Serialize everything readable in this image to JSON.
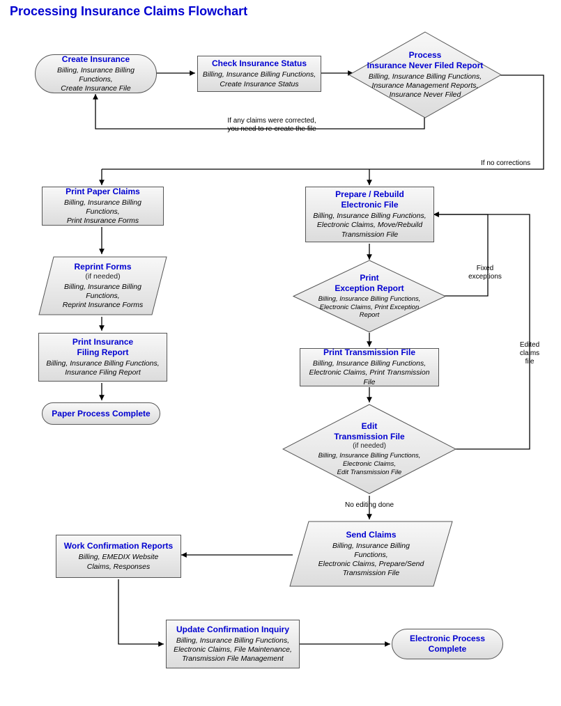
{
  "title": "Processing Insurance Claims Flowchart",
  "createInsurance": {
    "head": [
      "Create Insurance"
    ],
    "sub": [
      "Billing, Insurance Billing Functions,",
      "Create Insurance File"
    ]
  },
  "checkInsurance": {
    "head": [
      "Check Insurance Status"
    ],
    "sub": [
      "Billing, Insurance Billing Functions,",
      "Create Insurance Status"
    ]
  },
  "processNeverFiled": {
    "head": [
      "Process",
      "Insurance Never Filed Report"
    ],
    "sub": [
      "Billing, Insurance Billing Functions,",
      "Insurance Management Reports,",
      "Insurance Never Filed"
    ]
  },
  "printPaperClaims": {
    "head": [
      "Print Paper Claims"
    ],
    "sub": [
      "Billing, Insurance Billing Functions,",
      "Print  Insurance Forms"
    ]
  },
  "reprintForms": {
    "head": [
      "Reprint Forms"
    ],
    "headAfter": "(if needed)",
    "sub": [
      "Billing, Insurance Billing",
      "Functions,",
      "Reprint Insurance Forms"
    ]
  },
  "printFilingReport": {
    "head": [
      "Print Insurance",
      "Filing Report"
    ],
    "sub": [
      "Billing, Insurance Billing Functions,",
      "Insurance Filing Report"
    ]
  },
  "paperComplete": {
    "head": [
      "Paper Process Complete"
    ],
    "sub": []
  },
  "prepareRebuild": {
    "head": [
      "Prepare / Rebuild",
      "Electronic File"
    ],
    "sub": [
      "Billing, Insurance Billing Functions,",
      "Electronic Claims, Move/Rebuild",
      "Transmission File"
    ]
  },
  "printException": {
    "head": [
      "Print",
      "Exception Report"
    ],
    "sub": [
      "Billing, Insurance Billing Functions,",
      "Electronic Claims, Print Exception",
      "Report"
    ]
  },
  "printTransmission": {
    "head": [
      "Print Transmission File"
    ],
    "sub": [
      "Billing, Insurance Billing Functions,",
      "Electronic Claims, Print Transmission File"
    ]
  },
  "editTransmission": {
    "head": [
      "Edit",
      "Transmission File"
    ],
    "headAfter": "(if needed)",
    "sub": [
      "Billing, Insurance Billing Functions,",
      "Electronic Claims,",
      "Edit Transmission File"
    ]
  },
  "sendClaims": {
    "head": [
      "Send Claims"
    ],
    "sub": [
      "Billing, Insurance Billing",
      "Functions,",
      "Electronic Claims, Prepare/Send",
      "Transmission File"
    ]
  },
  "workConfirmation": {
    "head": [
      "Work Confirmation Reports"
    ],
    "sub": [
      "Billing, EMEDIX Website",
      "Claims, Responses"
    ]
  },
  "updateConfirmation": {
    "head": [
      "Update Confirmation Inquiry"
    ],
    "sub": [
      "Billing, Insurance Billing Functions,",
      "Electronic Claims, File Maintenance,",
      "Transmission File Management"
    ]
  },
  "electronicComplete": {
    "head": [
      "Electronic Process",
      "Complete"
    ],
    "sub": []
  },
  "labels": {
    "recreate": "If any claims were corrected,\nyou need to re-create the file",
    "noCorrections": "If no corrections",
    "fixedExc": "Fixed\nexceptions",
    "editedFile": "Edited\nclaims\nfile",
    "noEditing": "No editing done"
  }
}
